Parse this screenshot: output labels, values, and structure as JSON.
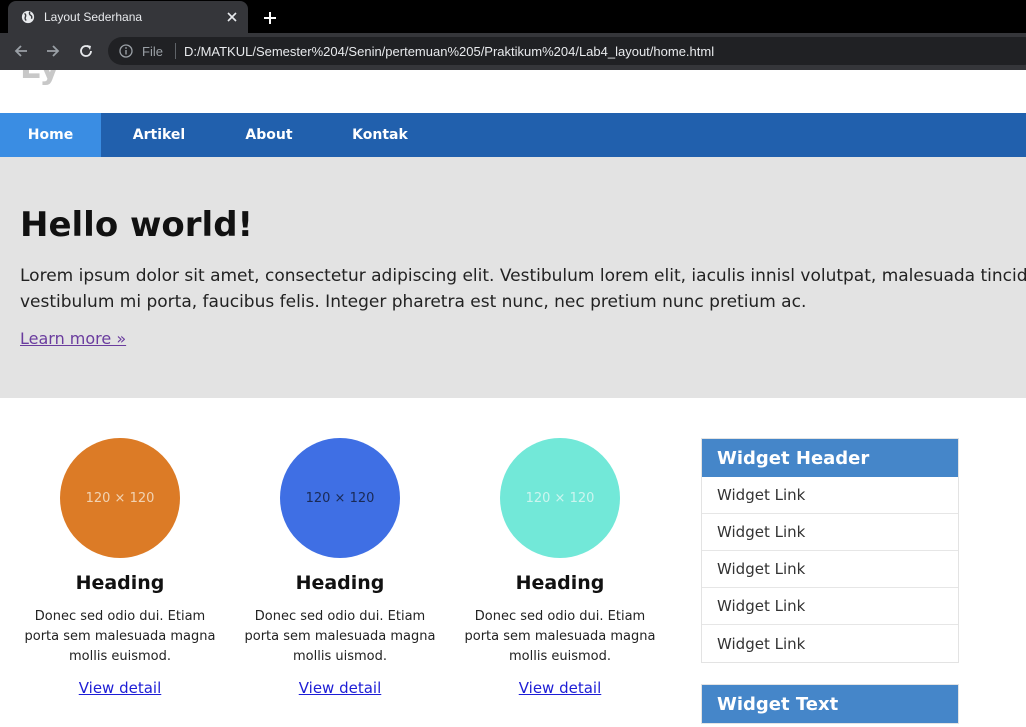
{
  "browser": {
    "tab_title": "Layout Sederhana",
    "url_scheme": "File",
    "url": "D:/MATKUL/Semester%204/Senin/pertemuan%205/Praktikum%204/Lab4_layout/home.html"
  },
  "nav": {
    "items": [
      {
        "label": "Home",
        "active": true
      },
      {
        "label": "Artikel",
        "active": false
      },
      {
        "label": "About",
        "active": false
      },
      {
        "label": "Kontak",
        "active": false
      }
    ]
  },
  "hero": {
    "title": "Hello world!",
    "text": "Lorem ipsum dolor sit amet, consectetur adipiscing elit. Vestibulum lorem elit, iaculis innisl volutpat, malesuada tincidunt vestibulum mi porta, faucibus felis. Integer pharetra est nunc, nec pretium nunc pretium ac.",
    "link": "Learn more »"
  },
  "features": [
    {
      "image_label": "120 × 120",
      "circle_color": "#dc7b26",
      "label_color": "#f1d3b3",
      "heading": "Heading",
      "text": "Donec sed odio dui. Etiam porta sem malesuada magna mollis euismod.",
      "link": "View detail"
    },
    {
      "image_label": "120 × 120",
      "circle_color": "#3f6fe4",
      "label_color": "#1a2a55",
      "heading": "Heading",
      "text": "Donec sed odio dui. Etiam porta sem malesuada magna mollis uismod.",
      "link": "View detail"
    },
    {
      "image_label": "120 × 120",
      "circle_color": "#72e8d8",
      "label_color": "#ccf5ef",
      "heading": "Heading",
      "text": "Donec sed odio dui. Etiam porta sem malesuada magna mollis euismod.",
      "link": "View detail"
    }
  ],
  "sidebar": {
    "widget_header": "Widget Header",
    "links": [
      "Widget Link",
      "Widget Link",
      "Widget Link",
      "Widget Link",
      "Widget Link"
    ],
    "widget_text_header": "Widget Text"
  },
  "colors": {
    "navbar": "#2160ad",
    "nav_active": "#3a8de3",
    "hero_bg": "#e3e3e3",
    "widget_header": "#4586c9"
  }
}
